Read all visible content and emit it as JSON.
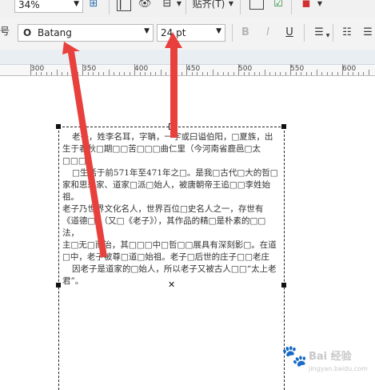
{
  "toolbar_top": {
    "zoom_value": "34%",
    "align_label": "贴齐(T)"
  },
  "toolbar_text": {
    "font_name": "Batang",
    "font_size": "24 pt",
    "bold_label": "B",
    "italic_label": "I",
    "underline_label": "U"
  },
  "ruler": {
    "labels": [
      "300",
      "350",
      "400",
      "450",
      "500",
      "550",
      "600"
    ]
  },
  "text_block": {
    "paragraphs": [
      "老子，姓李名耳，字聃，一字或曰谥伯阳，□夏族，出生于春秋□期□□苦□□□曲仁里（今河南省鹿邑□太□□□）",
      "□生活于前571年至471年之□。是我□古代□大的哲□家和思想家、道家□派□始人，被唐朝帝王追□□李姓始祖。",
      "老子乃世界文化名人，世界百位□史名人之一，存世有《道德□》（又□《老子》），其作品的精□是朴素的□□法，",
      "主□无□而治，其□□□中□哲□□展具有深刻影□。在道□中，老子被尊□道□始祖。老子□后世的庄子□□老庄",
      "因老子是道家的□始人，所以老子又被古人□□“太上老君”。"
    ]
  },
  "watermark": {
    "line1": "Bai 经验",
    "line2": "jingyan.baidu.com"
  },
  "colors": {
    "arrow": "#e8413d",
    "ruler_band": "#e9eef3"
  }
}
